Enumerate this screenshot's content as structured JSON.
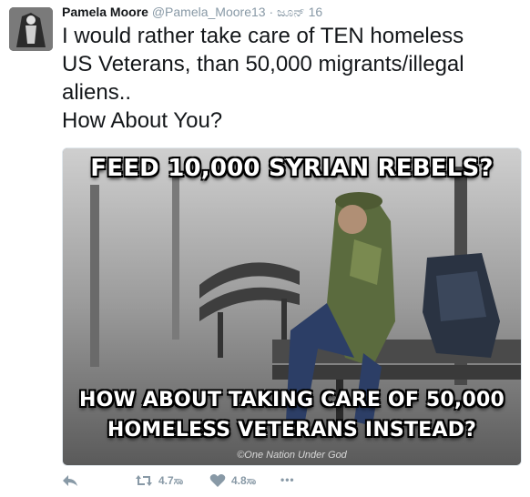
{
  "tweet": {
    "author_name": "Pamela Moore",
    "author_handle": "@Pamela_Moore13",
    "separator": "·",
    "date": "ಜೂನ್ 16",
    "text": "I would rather take care of TEN homeless\nUS Veterans, than 50,000 migrants/illegal\naliens..\nHow About You?"
  },
  "media": {
    "caption_top": "FEED 10,000 SYRIAN REBELS?",
    "caption_bottom_line1": "HOW ABOUT TAKING CARE OF 50,000",
    "caption_bottom_line2": "HOMELESS VETERANS INSTEAD?",
    "watermark": "©One Nation Under God"
  },
  "actions": {
    "retweet_count": "4.7ಸಾ",
    "like_count": "4.8ಸಾ",
    "more_label": "•••"
  },
  "icons": [
    "reply-icon",
    "retweet-icon",
    "heart-icon",
    "more-icon"
  ],
  "colors": {
    "text": "#14171a",
    "secondary_text": "#8899a6",
    "border": "#e1e8ed"
  }
}
